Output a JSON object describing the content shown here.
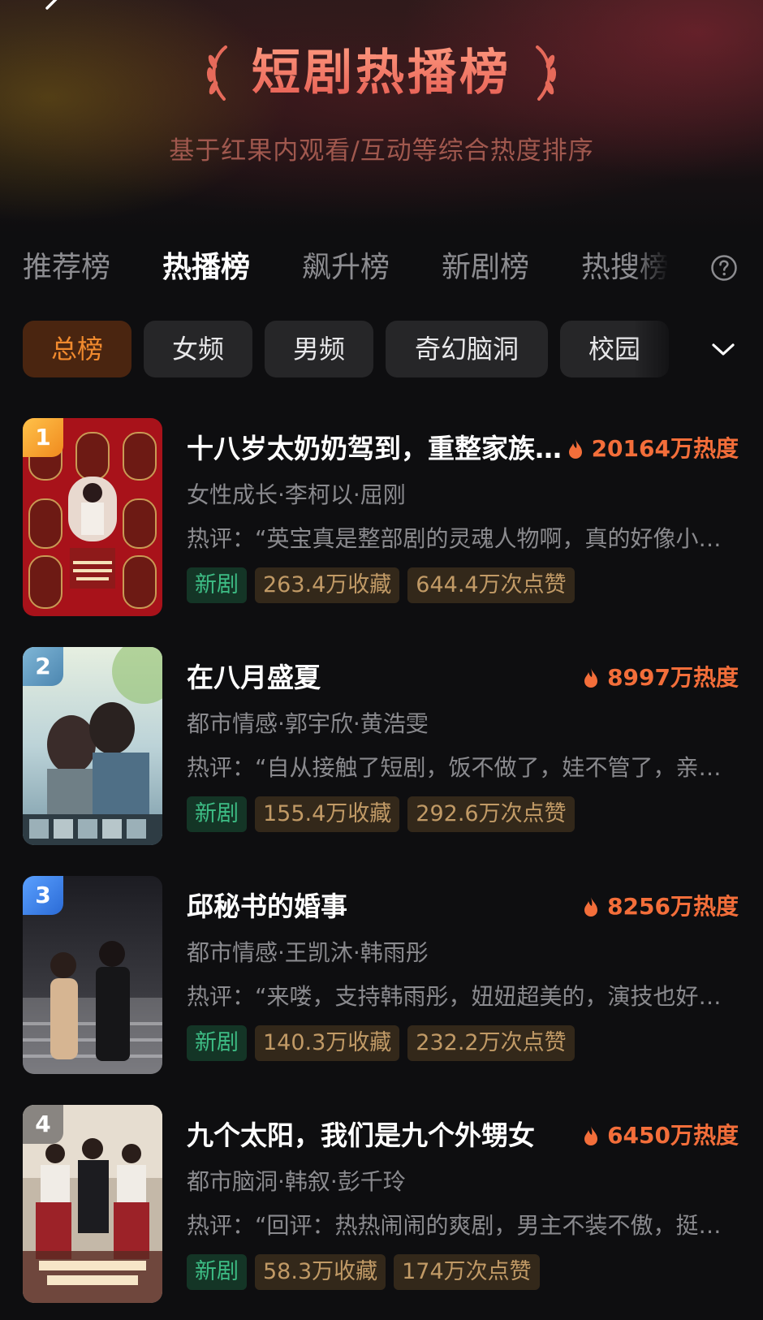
{
  "header": {
    "back_icon": "chevron-left-icon",
    "title": "短剧热播榜",
    "subtitle": "基于红果内观看/互动等综合热度排序"
  },
  "tabs": [
    {
      "label": "推荐榜",
      "active": false
    },
    {
      "label": "热播榜",
      "active": true
    },
    {
      "label": "飙升榜",
      "active": false
    },
    {
      "label": "新剧榜",
      "active": false
    },
    {
      "label": "热搜榜",
      "active": false
    }
  ],
  "help_icon": "question-circle-icon",
  "filters": [
    {
      "label": "总榜",
      "active": true
    },
    {
      "label": "女频",
      "active": false
    },
    {
      "label": "男频",
      "active": false
    },
    {
      "label": "奇幻脑洞",
      "active": false
    },
    {
      "label": "校园",
      "active": false
    }
  ],
  "expand_icon": "chevron-down-icon",
  "colors": {
    "accent": "#f36e3a",
    "active_chip_bg": "#4a2510",
    "active_chip_text": "#f18a2e",
    "new_tag_text": "#3dbd85",
    "stat_tag_text": "#c19a66"
  },
  "items": [
    {
      "rank": "1",
      "rank_color": "#f5a623",
      "title": "十八岁太奶奶驾到，重整家族…",
      "heat": "20164万热度",
      "meta": "女性成长·李柯以·屈刚",
      "review": "热评：“英宝真是整部剧的灵魂人物啊，真的好像小…",
      "tag_new": "新剧",
      "favorites": "263.4万收藏",
      "likes": "644.4万次点赞"
    },
    {
      "rank": "2",
      "rank_color": "#6aa4c8",
      "title": "在八月盛夏",
      "heat": "8997万热度",
      "meta": "都市情感·郭宇欣·黄浩雯",
      "review": "热评：“自从接触了短剧，饭不做了，娃不管了，亲…",
      "tag_new": "新剧",
      "favorites": "155.4万收藏",
      "likes": "292.6万次点赞"
    },
    {
      "rank": "3",
      "rank_color": "#3e7fe0",
      "title": "邱秘书的婚事",
      "heat": "8256万热度",
      "meta": "都市情感·王凯沐·韩雨彤",
      "review": "热评：“来喽，支持韩雨彤，妞妞超美的，演技也好…",
      "tag_new": "新剧",
      "favorites": "140.3万收藏",
      "likes": "232.2万次点赞"
    },
    {
      "rank": "4",
      "rank_color": "#6b6b70",
      "title": "九个太阳，我们是九个外甥女",
      "heat": "6450万热度",
      "meta": "都市脑洞·韩叙·彭千玲",
      "review": "热评：“回评：热热闹闹的爽剧，男主不装不傲，挺…",
      "tag_new": "新剧",
      "favorites": "58.3万收藏",
      "likes": "174万次点赞"
    }
  ]
}
